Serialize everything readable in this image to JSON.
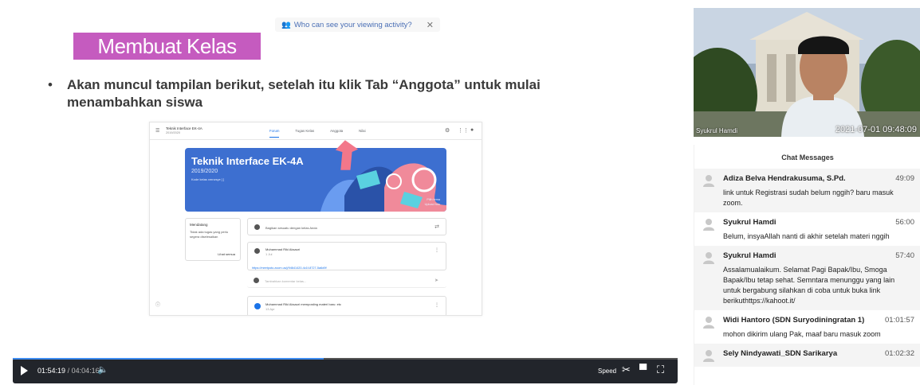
{
  "slide": {
    "privacy_text": "Who can see your viewing activity?",
    "title": "Membuat Kelas",
    "bullet_line1": "Akan muncul tampilan berikut, setelah itu klik Tab “Anggota”  untuk mulai",
    "bullet_line2": "menambahkan siswa"
  },
  "classroom": {
    "class_name": "Teknik Interface EK-4A",
    "class_year": "2019/2020",
    "tabs": [
      "Forum",
      "Tugas Kelas",
      "Anggota",
      "Nilai"
    ],
    "banner_title": "Teknik Interface EK-4A",
    "banner_year": "2019/2020",
    "banner_code": "Kode kelas  xmnzsye [ ]",
    "banner_info1": "Pilih tema",
    "banner_info2": "Upload foto",
    "upcoming_title": "Mendatang",
    "upcoming_text1": "Tidak ada tugas yang perlu",
    "upcoming_text2": "segera diselesaikan",
    "upcoming_link": "Lihat semua",
    "post1_text": "Bagikan sesuatu dengan kelas Anda",
    "post2_author": "Muhammad Riki Aksauri",
    "post2_time": "1 Jul",
    "post2_link": "https://meetpoto.zoom.us/j/94641420-4c1f-8727-5a6d9f",
    "post3_text": "Tambahkan komentar kelas...",
    "post4_text": "Muhammad Riki Aksauri memposting materi baru: etc",
    "post4_time": "13 Apr"
  },
  "player": {
    "current_time": "01:54:19",
    "total_time": "/ 04:04:16",
    "speed_label": "Speed",
    "progress": 0.468
  },
  "camera": {
    "name": "Syukrul Hamdi",
    "timestamp": "2021-07-01 09:48:09"
  },
  "chat": {
    "header": "Chat Messages",
    "messages": [
      {
        "name": "Adiza Belva Hendrakusuma, S.Pd.",
        "time": "49:09",
        "text": "link untuk Registrasi sudah belum nggih? baru masuk zoom."
      },
      {
        "name": "Syukrul Hamdi",
        "time": "56:00",
        "text": "Belum, insyaAllah nanti di akhir setelah materi nggih"
      },
      {
        "name": "Syukrul Hamdi",
        "time": "57:40",
        "text": "Assalamualaikum. Selamat Pagi Bapak/Ibu, Smoga Bapak/Ibu tetap sehat. Semntara menunggu yang lain untuk bergabung silahkan di coba untuk buka link berikuthttps://kahoot.it/"
      },
      {
        "name": "Widi Hantoro (SDN Suryodiningratan 1)",
        "time": "01:01:57",
        "text": "mohon dikirim ulang Pak, maaf baru masuk zoom"
      },
      {
        "name": "Sely Nindyawati_SDN Sarikarya",
        "time": "01:02:32",
        "text": ""
      }
    ]
  },
  "colors": {
    "title_bg": "#c55bbf",
    "banner_bg": "#3d6fd0",
    "control_bar": "#22252b",
    "progress_fill": "#3f8cf0"
  }
}
